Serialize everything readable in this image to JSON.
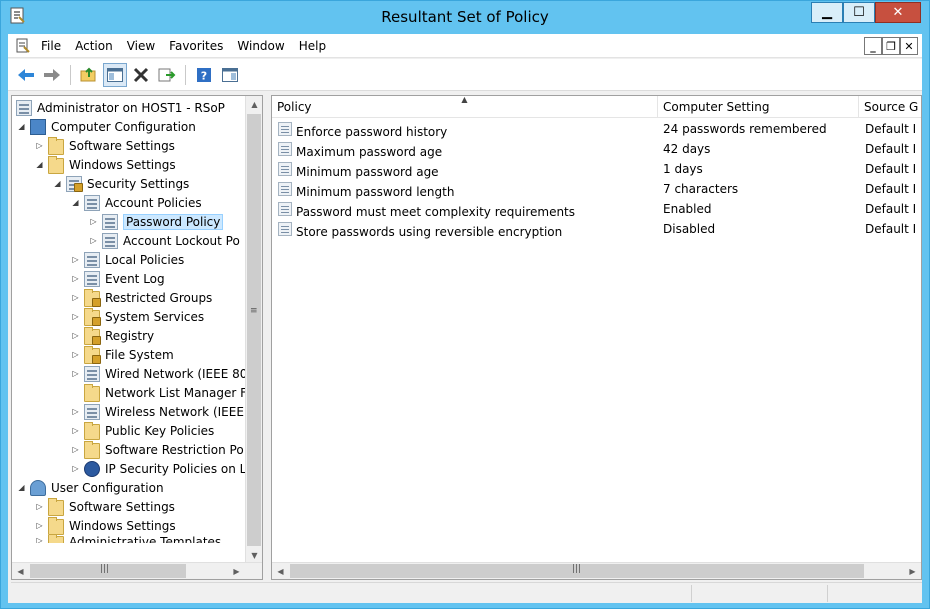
{
  "window": {
    "title": "Resultant Set of Policy"
  },
  "menu": {
    "items": [
      "File",
      "Action",
      "View",
      "Favorites",
      "Window",
      "Help"
    ]
  },
  "tree": {
    "root": "Administrator on HOST1 - RSoP",
    "computer_config": "Computer Configuration",
    "software_settings": "Software Settings",
    "windows_settings": "Windows Settings",
    "security_settings": "Security Settings",
    "account_policies": "Account Policies",
    "password_policy": "Password Policy",
    "account_lockout": "Account Lockout Po",
    "local_policies": "Local Policies",
    "event_log": "Event Log",
    "restricted_groups": "Restricted Groups",
    "system_services": "System Services",
    "registry": "Registry",
    "file_system": "File System",
    "wired_network": "Wired Network (IEEE 80",
    "network_list": "Network List Manager F",
    "wireless_network": "Wireless Network (IEEE",
    "public_key": "Public Key Policies",
    "software_restriction": "Software Restriction Po",
    "ip_security": "IP Security Policies on L",
    "user_config": "User Configuration",
    "user_software_settings": "Software Settings",
    "user_windows_settings": "Windows Settings",
    "admin_templates": "Administrative Templates"
  },
  "list": {
    "columns": [
      "Policy",
      "Computer Setting",
      "Source G"
    ],
    "rows": [
      {
        "policy": "Enforce password history",
        "setting": "24 passwords remembered",
        "source": "Default I"
      },
      {
        "policy": "Maximum password age",
        "setting": "42 days",
        "source": "Default I"
      },
      {
        "policy": "Minimum password age",
        "setting": "1 days",
        "source": "Default I"
      },
      {
        "policy": "Minimum password length",
        "setting": "7 characters",
        "source": "Default I"
      },
      {
        "policy": "Password must meet complexity requirements",
        "setting": "Enabled",
        "source": "Default I"
      },
      {
        "policy": "Store passwords using reversible encryption",
        "setting": "Disabled",
        "source": "Default I"
      }
    ]
  },
  "colors": {
    "titlebar": "#62c3f0",
    "selection": "#cce8ff",
    "close": "#c7503f"
  }
}
